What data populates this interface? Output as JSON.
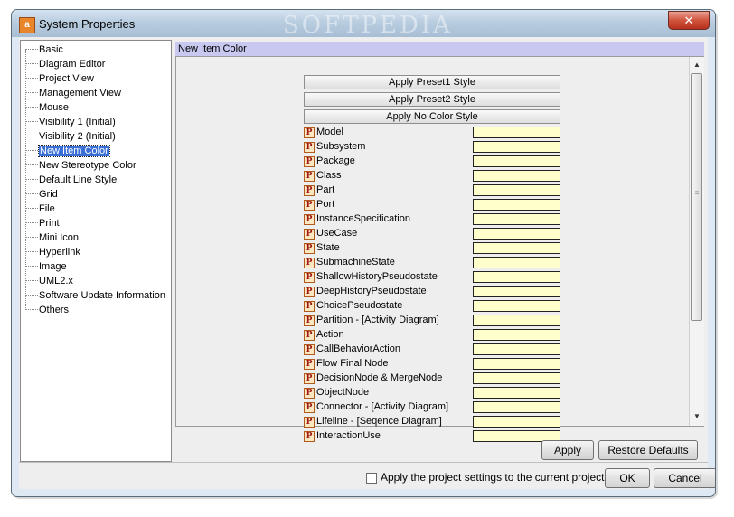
{
  "window": {
    "title": "System Properties",
    "icon_label": "a",
    "watermark": "SOFTPEDIA",
    "close_glyph": "✕"
  },
  "tree": {
    "items": [
      {
        "label": "Basic"
      },
      {
        "label": "Diagram Editor"
      },
      {
        "label": "Project View"
      },
      {
        "label": "Management View"
      },
      {
        "label": "Mouse"
      },
      {
        "label": "Visibility 1 (Initial)"
      },
      {
        "label": "Visibility 2 (Initial)"
      },
      {
        "label": "New Item Color",
        "selected": true
      },
      {
        "label": "New Stereotype Color"
      },
      {
        "label": "Default Line Style"
      },
      {
        "label": "Grid"
      },
      {
        "label": "File"
      },
      {
        "label": "Print"
      },
      {
        "label": "Mini Icon"
      },
      {
        "label": "Hyperlink"
      },
      {
        "label": "Image"
      },
      {
        "label": "UML2.x"
      },
      {
        "label": "Software Update Information"
      },
      {
        "label": "Others"
      }
    ]
  },
  "panel": {
    "header": "New Item Color",
    "preset_buttons": [
      "Apply Preset1 Style",
      "Apply Preset2 Style",
      "Apply No Color Style"
    ],
    "swatch_color": "#ffffcc",
    "icon_letter": "P",
    "rows": [
      "Model",
      "Subsystem",
      "Package",
      "Class",
      "Part",
      "Port",
      "InstanceSpecification",
      "UseCase",
      "State",
      "SubmachineState",
      "ShallowHistoryPseudostate",
      "DeepHistoryPseudostate",
      "ChoicePseudostate",
      "Partition - [Activity Diagram]",
      "Action",
      "CallBehaviorAction",
      "Flow Final Node",
      "DecisionNode & MergeNode",
      "ObjectNode",
      "Connector - [Activity Diagram]",
      "Lifeline - [Seqence Diagram]",
      "InteractionUse"
    ]
  },
  "buttons": {
    "apply": "Apply",
    "restore": "Restore Defaults",
    "ok": "OK",
    "cancel": "Cancel"
  },
  "footer": {
    "checkbox_label": "Apply the project settings to the current project",
    "checkbox_checked": false
  },
  "colors": {
    "selection": "#3a6fd8",
    "panel_header": "#c8c8f0",
    "swatch": "#ffffcc"
  }
}
